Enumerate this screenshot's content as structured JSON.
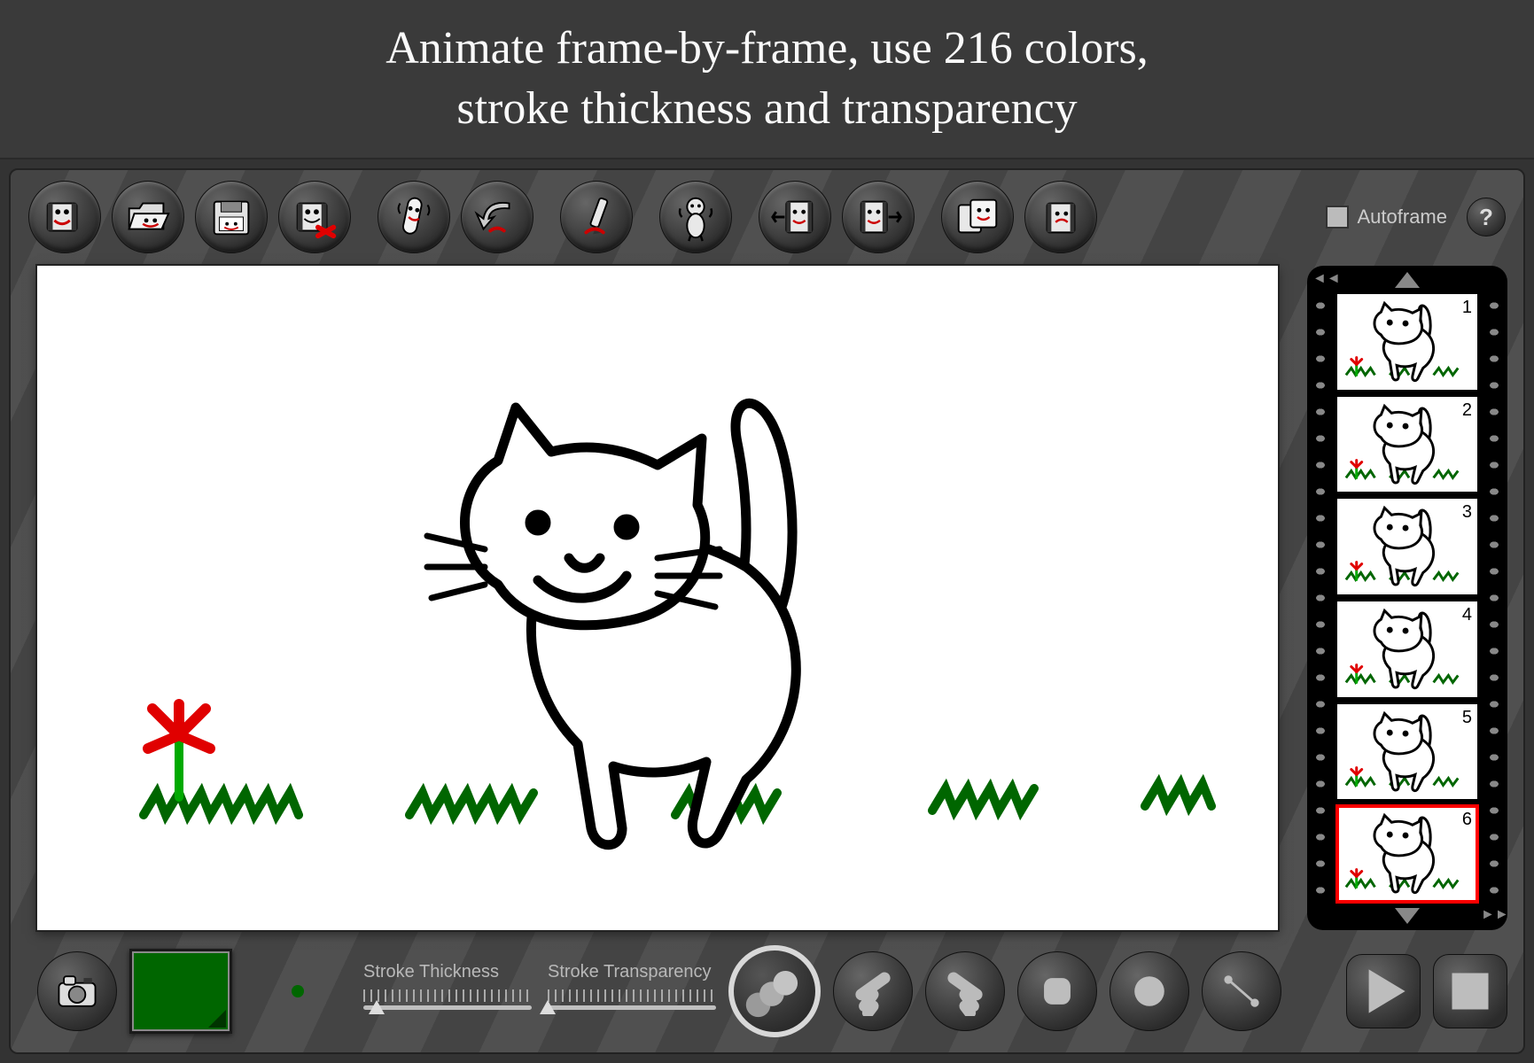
{
  "title": "Animate frame-by-frame, use 216 colors,\nstroke thickness and transparency",
  "toolbar": {
    "buttons": [
      {
        "name": "new-file-button",
        "icon": "film-new"
      },
      {
        "name": "open-file-button",
        "icon": "folder-open"
      },
      {
        "name": "save-file-button",
        "icon": "disk-save"
      },
      {
        "name": "close-file-button",
        "icon": "film-close"
      },
      {
        "name": "clear-frame-button",
        "icon": "eraser"
      },
      {
        "name": "undo-button",
        "icon": "undo"
      },
      {
        "name": "redo-button",
        "icon": "redo-pencil"
      },
      {
        "name": "character-button",
        "icon": "person"
      },
      {
        "name": "insert-frame-before-button",
        "icon": "film-insert-left"
      },
      {
        "name": "insert-frame-after-button",
        "icon": "film-insert-right"
      },
      {
        "name": "copy-frame-button",
        "icon": "film-copy"
      },
      {
        "name": "delete-frame-button",
        "icon": "film-delete"
      }
    ],
    "autoframe_label": "Autoframe",
    "autoframe_checked": false
  },
  "canvas": {
    "drawing": "cat-walking-with-grass-and-flower"
  },
  "filmstrip": {
    "frames": [
      1,
      2,
      3,
      4,
      5,
      6
    ],
    "current": 6
  },
  "bottom": {
    "camera_button": "snapshot-button",
    "current_color": "#006600",
    "brush_size_px": 14,
    "thickness_label": "Stroke Thickness",
    "transparency_label": "Stroke Transparency",
    "thickness_value": 0.08,
    "transparency_value": 0.0,
    "brush_button": "brush-tool-button",
    "shape_buttons": [
      {
        "name": "arrow-left-shape",
        "icon": "arrow-k"
      },
      {
        "name": "arrow-right-shape",
        "icon": "arrow-y"
      },
      {
        "name": "rounded-square-shape",
        "icon": "square"
      },
      {
        "name": "circle-shape",
        "icon": "circle"
      },
      {
        "name": "line-shape",
        "icon": "line"
      }
    ],
    "play_button": "play-button",
    "stop_button": "stop-button"
  }
}
